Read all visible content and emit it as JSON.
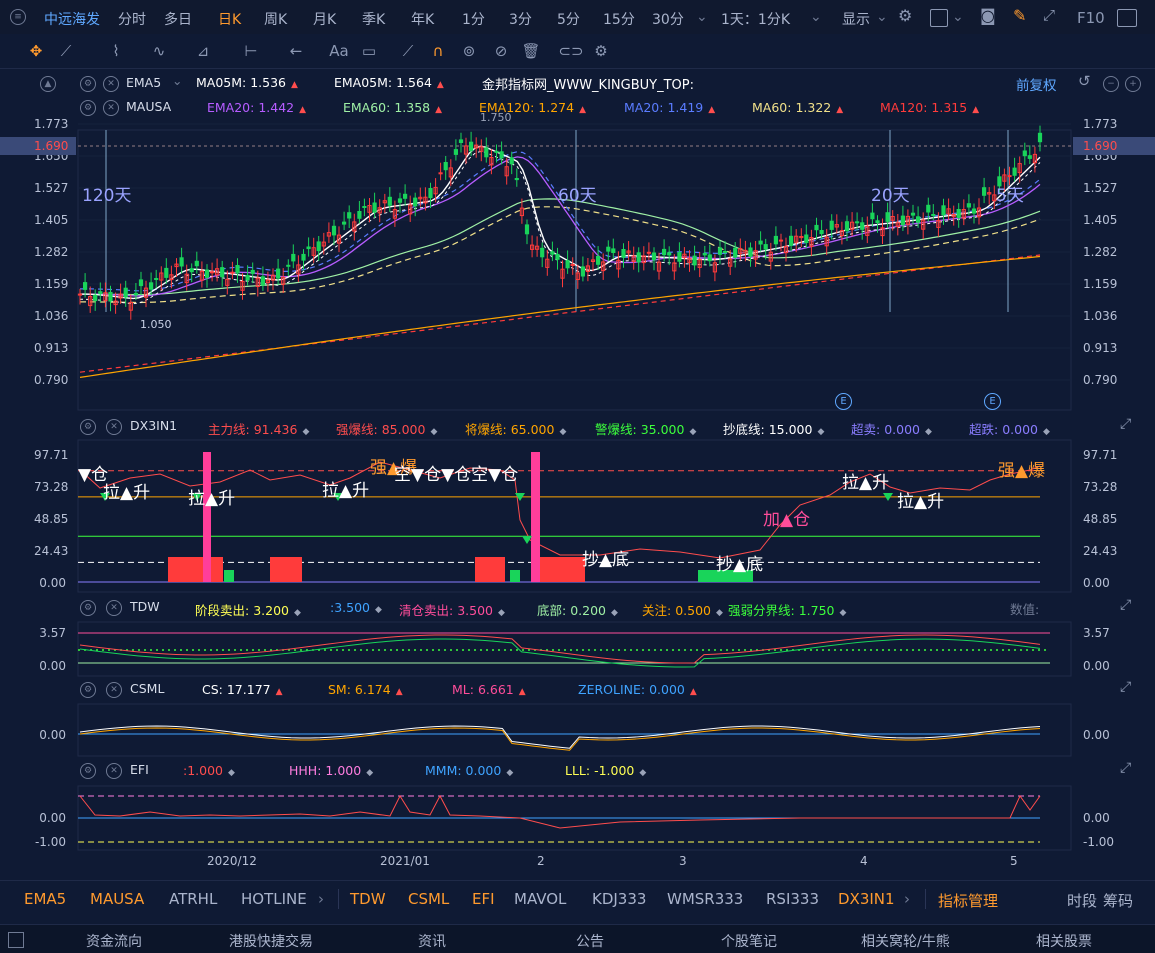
{
  "topbar": {
    "stock_name": "中远海发",
    "periods": [
      "分时",
      "多日",
      "日K",
      "周K",
      "月K",
      "季K",
      "年K",
      "1分",
      "3分",
      "5分",
      "15分",
      "30分"
    ],
    "active_period": "日K",
    "combo": "1天：1分K",
    "display_label": "显示",
    "f10_label": "F10"
  },
  "toolbar": {
    "text_tool": "Aa"
  },
  "main_panel": {
    "name_ema": "EMA5",
    "name_mausa": "MAUSA",
    "ema_items": [
      {
        "label": "MA05M: ",
        "value": "1.536",
        "color": "#ffffff"
      },
      {
        "label": "EMA05M: ",
        "value": "1.564",
        "color": "#ffffff"
      }
    ],
    "watermark": "金邦指标网_WWW_KINGBUY_TOP:",
    "adjust": "前复权",
    "mausa_items": [
      {
        "label": "EMA20: ",
        "value": "1.442",
        "color": "#b65cff"
      },
      {
        "label": "EMA60: ",
        "value": "1.358",
        "color": "#9ff0a5"
      },
      {
        "label": "EMA120: ",
        "value": "1.274",
        "color": "#ffa500"
      },
      {
        "label": "MA20: ",
        "value": "1.419",
        "color": "#5a7cff"
      },
      {
        "label": "MA60: ",
        "value": "1.322",
        "color": "#f0e08a"
      },
      {
        "label": "MA120: ",
        "value": "1.315",
        "color": "#ff3b3b"
      }
    ],
    "yaxis": [
      "1.773",
      "1.650",
      "1.527",
      "1.405",
      "1.282",
      "1.159",
      "1.036",
      "0.913",
      "0.790"
    ],
    "current_price": "1.690",
    "high_label": "1.750",
    "low_label": "1.050",
    "period_labels": [
      "120天",
      "60天",
      "20天",
      "5天"
    ],
    "e_marker": "E"
  },
  "dx_panel": {
    "name": "DX3IN1",
    "items": [
      {
        "label": "主力线: ",
        "value": "91.436",
        "color": "#ff4d4d"
      },
      {
        "label": "强爆线: ",
        "value": "85.000",
        "color": "#ff4d4d"
      },
      {
        "label": "将爆线: ",
        "value": "65.000",
        "color": "#ffa500"
      },
      {
        "label": "警爆线: ",
        "value": "35.000",
        "color": "#3cff3c"
      },
      {
        "label": "抄底线: ",
        "value": "15.000",
        "color": "#ffffff"
      },
      {
        "label": "超卖: ",
        "value": "0.000",
        "color": "#8a7dff"
      },
      {
        "label": "超跌: ",
        "value": "0.000",
        "color": "#8a7dff"
      }
    ],
    "yaxis": [
      "97.71",
      "73.28",
      "48.85",
      "24.43",
      "0.00"
    ],
    "markers": [
      "▼仓",
      "拉▲升",
      "拉▲升",
      "拉▲升",
      "强▲爆",
      "空▼仓▼仓空▼仓",
      "抄▲底",
      "抄▲底",
      "加▲仓",
      "拉▲升",
      "拉▲升",
      "强▲爆"
    ]
  },
  "tdw_panel": {
    "name": "TDW",
    "items": [
      {
        "label": "阶段卖出: ",
        "value": "3.200",
        "color": "#ffff55"
      },
      {
        "label": ":",
        "value": "3.500",
        "color": "#3fa3ff"
      },
      {
        "label": "清仓卖出: ",
        "value": "3.500",
        "color": "#ff4d9a"
      },
      {
        "label": "底部: ",
        "value": "0.200",
        "color": "#9ff0a5"
      },
      {
        "label": "关注: ",
        "value": "0.500",
        "color": "#ffa500"
      },
      {
        "label": "强弱分界线: ",
        "value": "1.750",
        "color": "#3cff3c"
      }
    ],
    "extra": "数值:",
    "yaxis": [
      "3.57",
      "0.00"
    ]
  },
  "csml_panel": {
    "name": "CSML",
    "items": [
      {
        "label": "CS: ",
        "value": "17.177",
        "color": "#ffffff"
      },
      {
        "label": "SM: ",
        "value": "6.174",
        "color": "#ffa500"
      },
      {
        "label": "ML: ",
        "value": "6.661",
        "color": "#ff4d9a"
      },
      {
        "label": "ZEROLINE: ",
        "value": "0.000",
        "color": "#3fa3ff"
      }
    ],
    "yaxis": [
      "0.00"
    ]
  },
  "efi_panel": {
    "name": "EFI",
    "items": [
      {
        "label": ":",
        "value": "1.000",
        "color": "#ff4d4d"
      },
      {
        "label": "HHH: ",
        "value": "1.000",
        "color": "#ff7de0"
      },
      {
        "label": "MMM: ",
        "value": "0.000",
        "color": "#3fa3ff"
      },
      {
        "label": "LLL: ",
        "value": "-1.000",
        "color": "#ffff55"
      }
    ],
    "yaxis": [
      "0.00",
      "-1.00"
    ]
  },
  "xaxis": [
    "2020/12",
    "2021/01",
    "2",
    "3",
    "4",
    "5"
  ],
  "tabs": [
    "EMA5",
    "MAUSA",
    "ATRHL",
    "HOTLINE",
    "TDW",
    "CSML",
    "EFI",
    "MAVOL",
    "KDJ333",
    "WMSR333",
    "RSI333",
    "DX3IN1",
    "指标管理",
    "时段",
    "筹码"
  ],
  "footer": [
    "资金流向",
    "港股快捷交易",
    "资讯",
    "公告",
    "个股笔记",
    "相关窝轮/牛熊",
    "相关股票"
  ],
  "colors": {
    "up": "#ff3b3b",
    "down": "#19d45a",
    "bg": "#0f1a34",
    "accent": "#ff9a2e"
  }
}
